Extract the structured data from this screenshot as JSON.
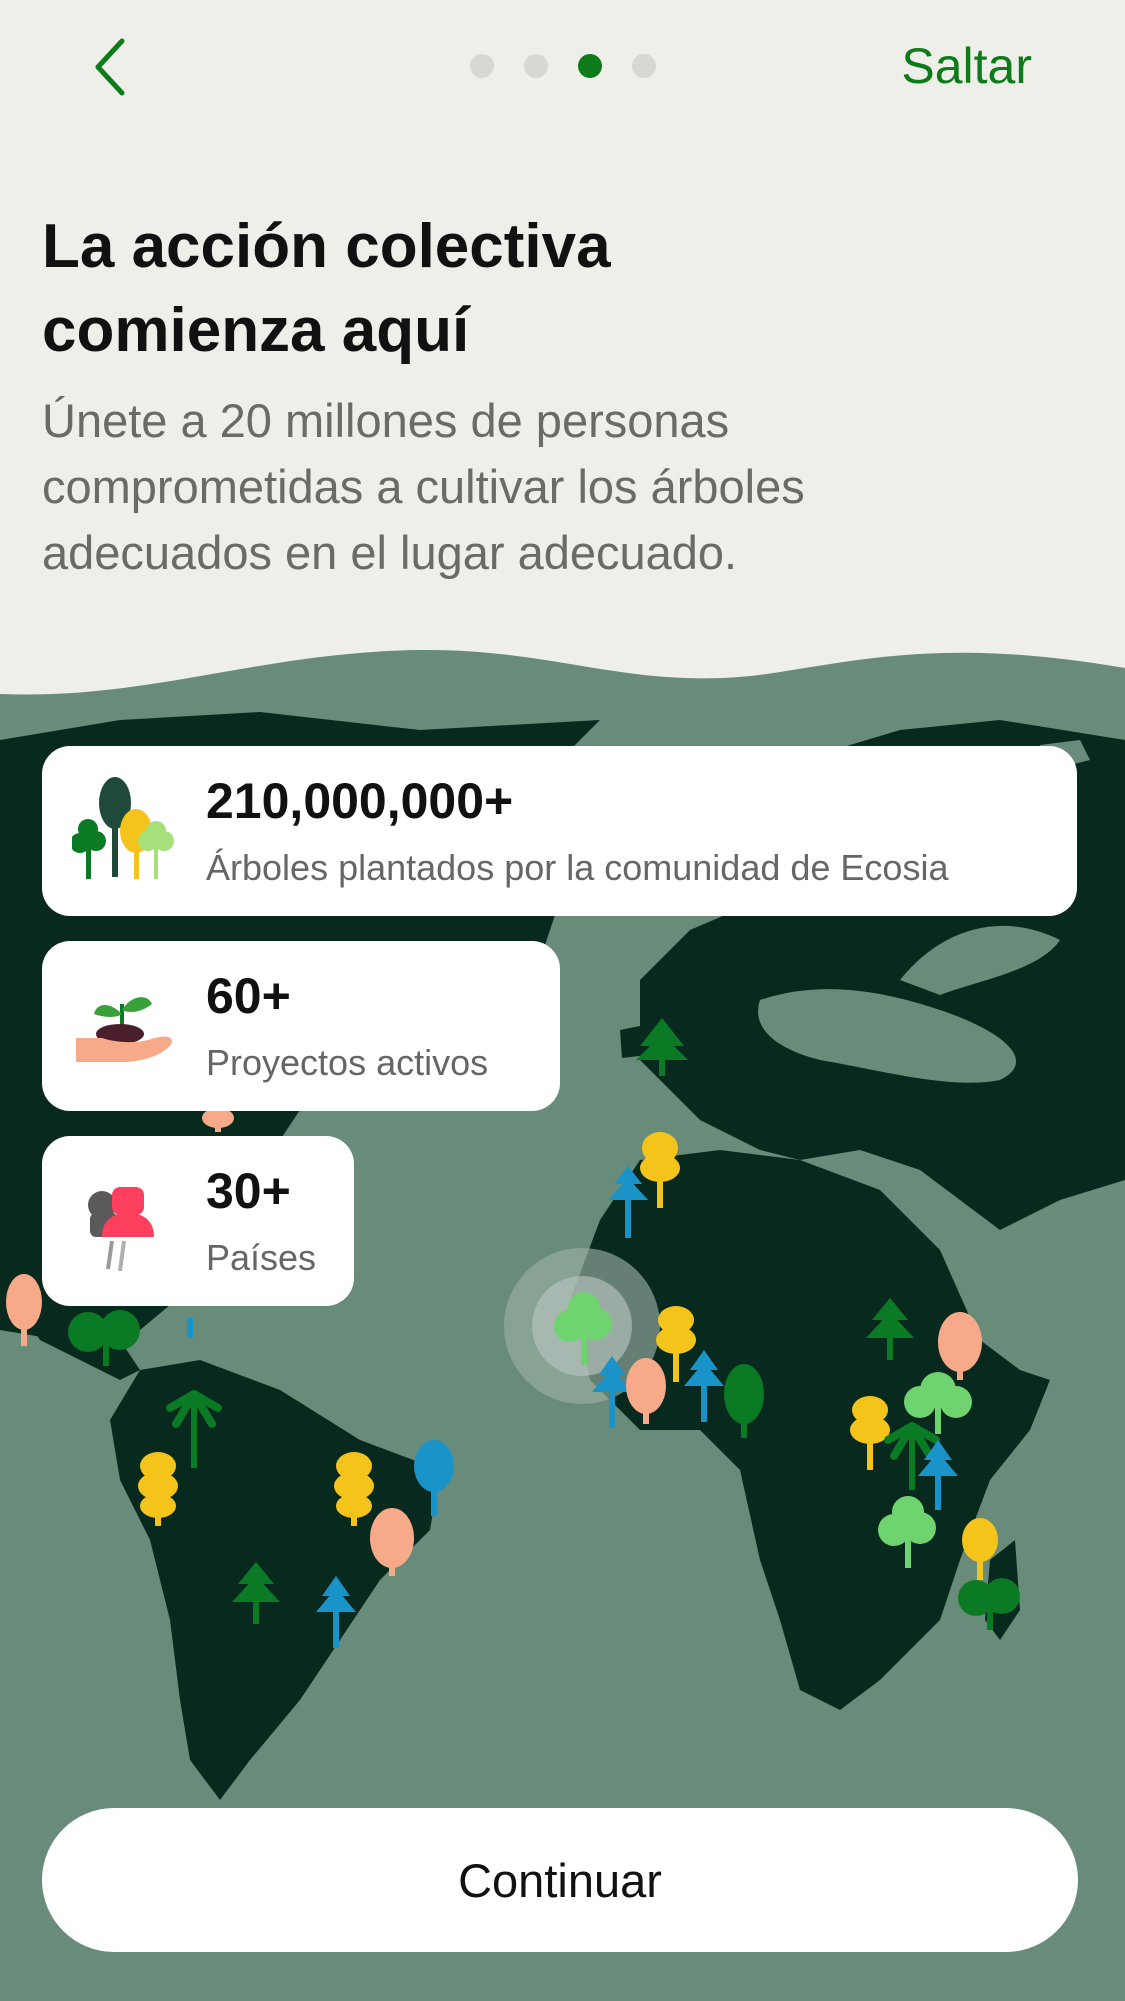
{
  "header": {
    "back_icon": "chevron-left-icon",
    "pager": {
      "total": 4,
      "active_index": 2
    },
    "skip_label": "Saltar"
  },
  "intro": {
    "title_line1": "La acción colectiva",
    "title_line2": "comienza aquí",
    "subtitle_line1": "Únete a 20 millones de personas",
    "subtitle_line2": "comprometidas a cultivar los árboles",
    "subtitle_line3": "adecuados en el lugar adecuado."
  },
  "stats": [
    {
      "icon": "trees-icon",
      "value": "210,000,000+",
      "label": "Árboles plantados por la comunidad de Ecosia"
    },
    {
      "icon": "seedling-hand-icon",
      "value": "60+",
      "label": "Proyectos activos"
    },
    {
      "icon": "pushpin-icon",
      "value": "30+",
      "label": "Países"
    }
  ],
  "footer": {
    "continue_label": "Continuar"
  },
  "colors": {
    "accent_green": "#0e7b1a",
    "background": "#efefea",
    "map_water": "#698c7a",
    "map_land": "#082a1e",
    "tree_yellow": "#f5c41a",
    "tree_blue": "#1a93c8",
    "tree_peach": "#f7aa8a",
    "tree_green": "#0b7a24",
    "tree_lightgreen": "#6fd36f"
  }
}
